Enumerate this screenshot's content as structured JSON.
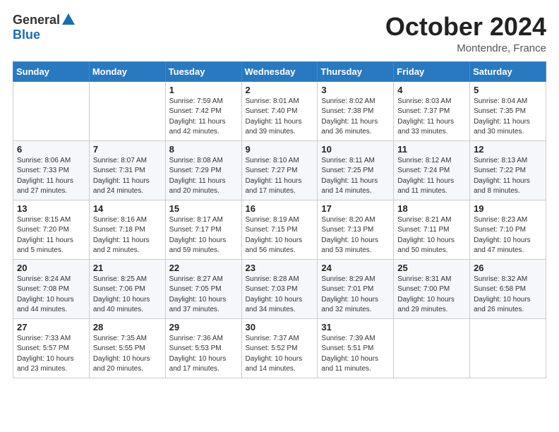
{
  "header": {
    "logo_general": "General",
    "logo_blue": "Blue",
    "month_title": "October 2024",
    "subtitle": "Montendre, France"
  },
  "days_of_week": [
    "Sunday",
    "Monday",
    "Tuesday",
    "Wednesday",
    "Thursday",
    "Friday",
    "Saturday"
  ],
  "weeks": [
    [
      {
        "day": "",
        "sunrise": "",
        "sunset": "",
        "daylight": ""
      },
      {
        "day": "",
        "sunrise": "",
        "sunset": "",
        "daylight": ""
      },
      {
        "day": "1",
        "sunrise": "Sunrise: 7:59 AM",
        "sunset": "Sunset: 7:42 PM",
        "daylight": "Daylight: 11 hours and 42 minutes."
      },
      {
        "day": "2",
        "sunrise": "Sunrise: 8:01 AM",
        "sunset": "Sunset: 7:40 PM",
        "daylight": "Daylight: 11 hours and 39 minutes."
      },
      {
        "day": "3",
        "sunrise": "Sunrise: 8:02 AM",
        "sunset": "Sunset: 7:38 PM",
        "daylight": "Daylight: 11 hours and 36 minutes."
      },
      {
        "day": "4",
        "sunrise": "Sunrise: 8:03 AM",
        "sunset": "Sunset: 7:37 PM",
        "daylight": "Daylight: 11 hours and 33 minutes."
      },
      {
        "day": "5",
        "sunrise": "Sunrise: 8:04 AM",
        "sunset": "Sunset: 7:35 PM",
        "daylight": "Daylight: 11 hours and 30 minutes."
      }
    ],
    [
      {
        "day": "6",
        "sunrise": "Sunrise: 8:06 AM",
        "sunset": "Sunset: 7:33 PM",
        "daylight": "Daylight: 11 hours and 27 minutes."
      },
      {
        "day": "7",
        "sunrise": "Sunrise: 8:07 AM",
        "sunset": "Sunset: 7:31 PM",
        "daylight": "Daylight: 11 hours and 24 minutes."
      },
      {
        "day": "8",
        "sunrise": "Sunrise: 8:08 AM",
        "sunset": "Sunset: 7:29 PM",
        "daylight": "Daylight: 11 hours and 20 minutes."
      },
      {
        "day": "9",
        "sunrise": "Sunrise: 8:10 AM",
        "sunset": "Sunset: 7:27 PM",
        "daylight": "Daylight: 11 hours and 17 minutes."
      },
      {
        "day": "10",
        "sunrise": "Sunrise: 8:11 AM",
        "sunset": "Sunset: 7:25 PM",
        "daylight": "Daylight: 11 hours and 14 minutes."
      },
      {
        "day": "11",
        "sunrise": "Sunrise: 8:12 AM",
        "sunset": "Sunset: 7:24 PM",
        "daylight": "Daylight: 11 hours and 11 minutes."
      },
      {
        "day": "12",
        "sunrise": "Sunrise: 8:13 AM",
        "sunset": "Sunset: 7:22 PM",
        "daylight": "Daylight: 11 hours and 8 minutes."
      }
    ],
    [
      {
        "day": "13",
        "sunrise": "Sunrise: 8:15 AM",
        "sunset": "Sunset: 7:20 PM",
        "daylight": "Daylight: 11 hours and 5 minutes."
      },
      {
        "day": "14",
        "sunrise": "Sunrise: 8:16 AM",
        "sunset": "Sunset: 7:18 PM",
        "daylight": "Daylight: 11 hours and 2 minutes."
      },
      {
        "day": "15",
        "sunrise": "Sunrise: 8:17 AM",
        "sunset": "Sunset: 7:17 PM",
        "daylight": "Daylight: 10 hours and 59 minutes."
      },
      {
        "day": "16",
        "sunrise": "Sunrise: 8:19 AM",
        "sunset": "Sunset: 7:15 PM",
        "daylight": "Daylight: 10 hours and 56 minutes."
      },
      {
        "day": "17",
        "sunrise": "Sunrise: 8:20 AM",
        "sunset": "Sunset: 7:13 PM",
        "daylight": "Daylight: 10 hours and 53 minutes."
      },
      {
        "day": "18",
        "sunrise": "Sunrise: 8:21 AM",
        "sunset": "Sunset: 7:11 PM",
        "daylight": "Daylight: 10 hours and 50 minutes."
      },
      {
        "day": "19",
        "sunrise": "Sunrise: 8:23 AM",
        "sunset": "Sunset: 7:10 PM",
        "daylight": "Daylight: 10 hours and 47 minutes."
      }
    ],
    [
      {
        "day": "20",
        "sunrise": "Sunrise: 8:24 AM",
        "sunset": "Sunset: 7:08 PM",
        "daylight": "Daylight: 10 hours and 44 minutes."
      },
      {
        "day": "21",
        "sunrise": "Sunrise: 8:25 AM",
        "sunset": "Sunset: 7:06 PM",
        "daylight": "Daylight: 10 hours and 40 minutes."
      },
      {
        "day": "22",
        "sunrise": "Sunrise: 8:27 AM",
        "sunset": "Sunset: 7:05 PM",
        "daylight": "Daylight: 10 hours and 37 minutes."
      },
      {
        "day": "23",
        "sunrise": "Sunrise: 8:28 AM",
        "sunset": "Sunset: 7:03 PM",
        "daylight": "Daylight: 10 hours and 34 minutes."
      },
      {
        "day": "24",
        "sunrise": "Sunrise: 8:29 AM",
        "sunset": "Sunset: 7:01 PM",
        "daylight": "Daylight: 10 hours and 32 minutes."
      },
      {
        "day": "25",
        "sunrise": "Sunrise: 8:31 AM",
        "sunset": "Sunset: 7:00 PM",
        "daylight": "Daylight: 10 hours and 29 minutes."
      },
      {
        "day": "26",
        "sunrise": "Sunrise: 8:32 AM",
        "sunset": "Sunset: 6:58 PM",
        "daylight": "Daylight: 10 hours and 26 minutes."
      }
    ],
    [
      {
        "day": "27",
        "sunrise": "Sunrise: 7:33 AM",
        "sunset": "Sunset: 5:57 PM",
        "daylight": "Daylight: 10 hours and 23 minutes."
      },
      {
        "day": "28",
        "sunrise": "Sunrise: 7:35 AM",
        "sunset": "Sunset: 5:55 PM",
        "daylight": "Daylight: 10 hours and 20 minutes."
      },
      {
        "day": "29",
        "sunrise": "Sunrise: 7:36 AM",
        "sunset": "Sunset: 5:53 PM",
        "daylight": "Daylight: 10 hours and 17 minutes."
      },
      {
        "day": "30",
        "sunrise": "Sunrise: 7:37 AM",
        "sunset": "Sunset: 5:52 PM",
        "daylight": "Daylight: 10 hours and 14 minutes."
      },
      {
        "day": "31",
        "sunrise": "Sunrise: 7:39 AM",
        "sunset": "Sunset: 5:51 PM",
        "daylight": "Daylight: 10 hours and 11 minutes."
      },
      {
        "day": "",
        "sunrise": "",
        "sunset": "",
        "daylight": ""
      },
      {
        "day": "",
        "sunrise": "",
        "sunset": "",
        "daylight": ""
      }
    ]
  ]
}
